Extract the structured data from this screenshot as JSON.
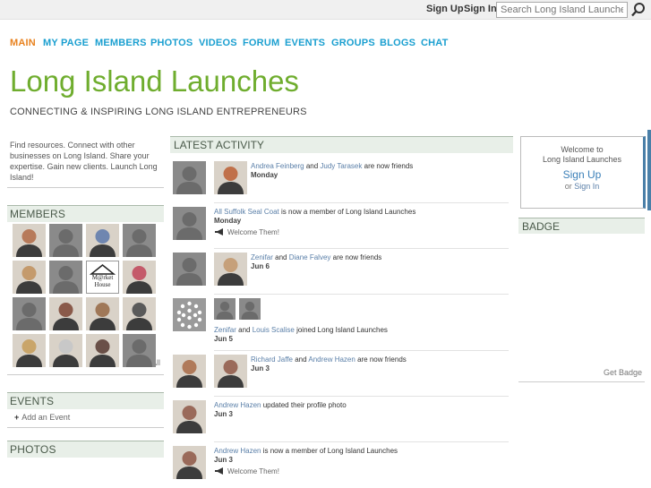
{
  "userbar": {
    "signup": "Sign Up",
    "signin": "Sign In",
    "search_placeholder": "Search Long Island Launches"
  },
  "nav": [
    {
      "label": "MAIN",
      "active": true
    },
    {
      "label": "MY PAGE"
    },
    {
      "label": "MEMBERS"
    },
    {
      "label": "PHOTOS"
    },
    {
      "label": "VIDEOS"
    },
    {
      "label": "FORUM"
    },
    {
      "label": "EVENTS"
    },
    {
      "label": "GROUPS"
    },
    {
      "label": "BLOGS"
    },
    {
      "label": "CHAT"
    }
  ],
  "site": {
    "title": "Long Island Launches",
    "tagline": "CONNECTING & INSPIRING LONG ISLAND ENTREPRENEURS"
  },
  "left": {
    "description": "Find resources. Connect with other businesses on Long Island. Share your expertise. Gain new clients. Launch Long Island!",
    "members_title": "MEMBERS",
    "view_all": "View All",
    "events_title": "EVENTS",
    "add_event": "Add an Event",
    "photos_title": "PHOTOS",
    "members": [
      {
        "kind": "photo",
        "color": "#b77a5a"
      },
      {
        "kind": "silhouette"
      },
      {
        "kind": "photo",
        "color": "#6f86b0"
      },
      {
        "kind": "silhouette"
      },
      {
        "kind": "photo",
        "color": "#c49a6c"
      },
      {
        "kind": "silhouette"
      },
      {
        "kind": "logo",
        "text1": "M@rket",
        "text2": "House"
      },
      {
        "kind": "photo",
        "color": "#c45a6a"
      },
      {
        "kind": "silhouette"
      },
      {
        "kind": "photo",
        "color": "#8a5a4a"
      },
      {
        "kind": "photo",
        "color": "#a07858"
      },
      {
        "kind": "photo",
        "color": "#5a5a5a"
      },
      {
        "kind": "photo",
        "color": "#c9a56a"
      },
      {
        "kind": "photo",
        "color": "#c8c8c8"
      },
      {
        "kind": "photo",
        "color": "#6a5048"
      },
      {
        "kind": "silhouette"
      }
    ]
  },
  "center": {
    "latest_title": "LATEST ACTIVITY",
    "activity": [
      {
        "name1": "Andrea Feinberg",
        "mid": " and ",
        "name2": "Judy Tarasek",
        "rest": " are now friends",
        "when": "Monday",
        "welcome": ""
      },
      {
        "name1": "All Suffolk Seal Coat",
        "mid": " is now a member of Long Island Launches",
        "name2": "",
        "rest": "",
        "when": "Monday",
        "welcome": "Welcome Them!"
      },
      {
        "name1": "Zenifar",
        "mid": " and ",
        "name2": "Diane Falvey",
        "rest": " are now friends",
        "when": "Jun 6",
        "welcome": ""
      },
      {
        "name1": "Zenifar",
        "mid": " and ",
        "name2": "Louis Scalise",
        "rest": " joined Long Island Launches",
        "when": "Jun 5",
        "welcome": ""
      },
      {
        "name1": "Richard Jaffe",
        "mid": " and ",
        "name2": "Andrew Hazen",
        "rest": " are now friends",
        "when": "Jun 3",
        "welcome": ""
      },
      {
        "name1": "Andrew Hazen",
        "mid": " updated their profile photo",
        "name2": "",
        "rest": "",
        "when": "Jun 3",
        "welcome": ""
      },
      {
        "name1": "Andrew Hazen",
        "mid": " is now a member of Long Island Launches",
        "name2": "",
        "rest": "",
        "when": "Jun 3",
        "welcome": "Welcome Them!"
      }
    ]
  },
  "right": {
    "welcome_line1": "Welcome to",
    "welcome_line2": "Long Island Launches",
    "signup": "Sign Up",
    "or": "or ",
    "signin": "Sign In",
    "badge_title": "BADGE",
    "get_badge": "Get Badge"
  },
  "colors": {
    "title_green": "#6fad2e",
    "nav_blue": "#1a9fd0",
    "nav_active": "#e8821f",
    "link_blue": "#5a7fa8"
  },
  "icons": {
    "search": "magnifier-icon",
    "plus": "plus-icon",
    "megaphone": "megaphone-icon"
  }
}
